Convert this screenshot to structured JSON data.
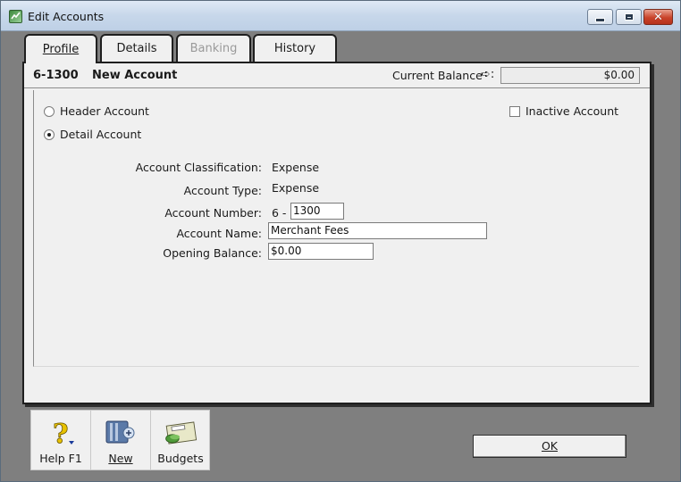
{
  "window": {
    "title": "Edit Accounts"
  },
  "tabs": [
    {
      "label": "Profile",
      "state": "active"
    },
    {
      "label": "Details",
      "state": "normal"
    },
    {
      "label": "Banking",
      "state": "disabled"
    },
    {
      "label": "History",
      "state": "normal"
    }
  ],
  "header": {
    "account_number": "6-1300",
    "account_name": "New Account",
    "current_balance_label": "Current Balance",
    "current_balance_arrow": "➪:",
    "current_balance_value": "$0.00"
  },
  "account_kind": {
    "header_label": "Header Account",
    "detail_label": "Detail Account",
    "selected": "detail"
  },
  "inactive": {
    "label": "Inactive Account",
    "checked": false
  },
  "fields": {
    "classification_label": "Account Classification:",
    "classification_value": "Expense",
    "type_label": "Account Type:",
    "type_value": "Expense",
    "number_label": "Account Number:",
    "number_prefix": "6 -",
    "number_value": "1300",
    "name_label": "Account Name:",
    "name_value": "Merchant Fees",
    "opening_label": "Opening Balance:",
    "opening_value": "$0.00"
  },
  "toolbar": {
    "help_label": "Help F1",
    "new_label": "New",
    "budgets_label": "Budgets",
    "help_icon": "question-mark-icon",
    "new_icon": "book-icon",
    "budgets_icon": "budget-card-icon"
  },
  "actions": {
    "ok_label": "OK"
  },
  "colors": {
    "background": "#7f7f7f",
    "panel": "#f0f0f0",
    "close_button": "#c9432a"
  }
}
